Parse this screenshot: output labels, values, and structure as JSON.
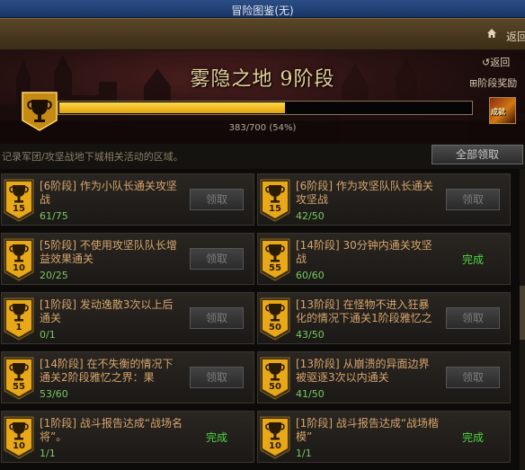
{
  "window": {
    "title": "冒险图鉴(无)"
  },
  "nav": {
    "back_label": "返回"
  },
  "banner": {
    "stage_title": "雾隐之地 9阶段",
    "back_label": "返回",
    "stage_reward_label": "阶段奖励",
    "reward_badge": "成就",
    "progress": {
      "current": 383,
      "total": 700,
      "percent": 54,
      "text": "383/700 (54%)"
    }
  },
  "subbar": {
    "description": "记录军团/攻坚战地下城相关活动的区域。",
    "claim_all_label": "全部领取"
  },
  "colors": {
    "trophy_gold": "#f0b818",
    "progress_fill": "#f4c023",
    "done_green": "#4ed640"
  },
  "cards": [
    {
      "level": "15",
      "text": "[6阶段] 作为小队长通关攻坚战",
      "progress": "61/75",
      "state": "claim",
      "action_label": "领取"
    },
    {
      "level": "15",
      "text": "[6阶段] 作为攻坚队队长通关攻坚战",
      "progress": "42/50",
      "state": "claim",
      "action_label": "领取"
    },
    {
      "level": "10",
      "text": "[5阶段] 不使用攻坚队队长增益效果通关",
      "progress": "20/25",
      "state": "claim",
      "action_label": "领取"
    },
    {
      "level": "55",
      "text": "[14阶段] 30分钟内通关攻坚战",
      "progress": "60/60",
      "state": "done",
      "action_label": "完成"
    },
    {
      "level": "1",
      "text": "[1阶段] 发动逸散3次以上后通关",
      "progress": "0/1",
      "state": "claim",
      "action_label": "领取"
    },
    {
      "level": "50",
      "text": "[13阶段] 在怪物不进入狂暴化的情况下通关1阶段雅忆之",
      "progress": "43/50",
      "state": "claim",
      "action_label": "领取"
    },
    {
      "level": "55",
      "text": "[14阶段] 在不失衡的情况下通关2阶段雅忆之界：果",
      "progress": "53/60",
      "state": "claim",
      "action_label": "领取"
    },
    {
      "level": "50",
      "text": "[13阶段] 从崩溃的异面边界被驱逐3次以内通关",
      "progress": "41/50",
      "state": "claim",
      "action_label": "领取"
    },
    {
      "level": "10",
      "text": "[1阶段] 战斗报告达成“战场名将”。",
      "progress": "1/1",
      "state": "done",
      "action_label": "完成"
    },
    {
      "level": "10",
      "text": "[1阶段] 战斗报告达成“战场楷模”",
      "progress": "1/1",
      "state": "done",
      "action_label": "完成"
    }
  ]
}
